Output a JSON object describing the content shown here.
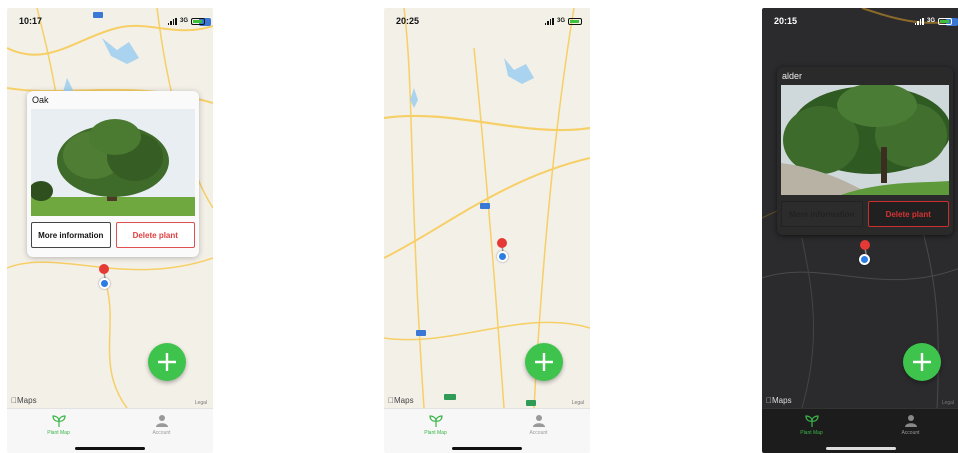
{
  "screens": [
    {
      "status": {
        "time": "10:17",
        "network": "3G"
      },
      "callout": {
        "title": "Oak",
        "more_info": "More information",
        "delete": "Delete plant"
      },
      "map": {
        "theme": "light",
        "maps_label": "Maps",
        "legal_label": "Legal"
      },
      "tabs": [
        {
          "label": "Plant Map",
          "icon": "sprout-icon"
        },
        {
          "label": "Account",
          "icon": "person-icon"
        }
      ]
    },
    {
      "status": {
        "time": "20:25",
        "network": "3G"
      },
      "map": {
        "theme": "light",
        "maps_label": "Maps",
        "legal_label": "Legal"
      },
      "tabs": [
        {
          "label": "Plant Map",
          "icon": "sprout-icon"
        },
        {
          "label": "Account",
          "icon": "person-icon"
        }
      ]
    },
    {
      "status": {
        "time": "20:15",
        "network": "3G"
      },
      "callout": {
        "title": "alder",
        "more_info": "More information",
        "delete": "Delete plant"
      },
      "map": {
        "theme": "dark",
        "maps_label": "Maps",
        "legal_label": "Legal"
      },
      "tabs": [
        {
          "label": "Plant Map",
          "icon": "sprout-icon"
        },
        {
          "label": "Account",
          "icon": "person-icon"
        }
      ]
    }
  ],
  "colors": {
    "accent_green": "#3ec34d",
    "delete_red": "#e04040",
    "user_location_blue": "#2a7de1",
    "pin_red": "#e53935"
  }
}
